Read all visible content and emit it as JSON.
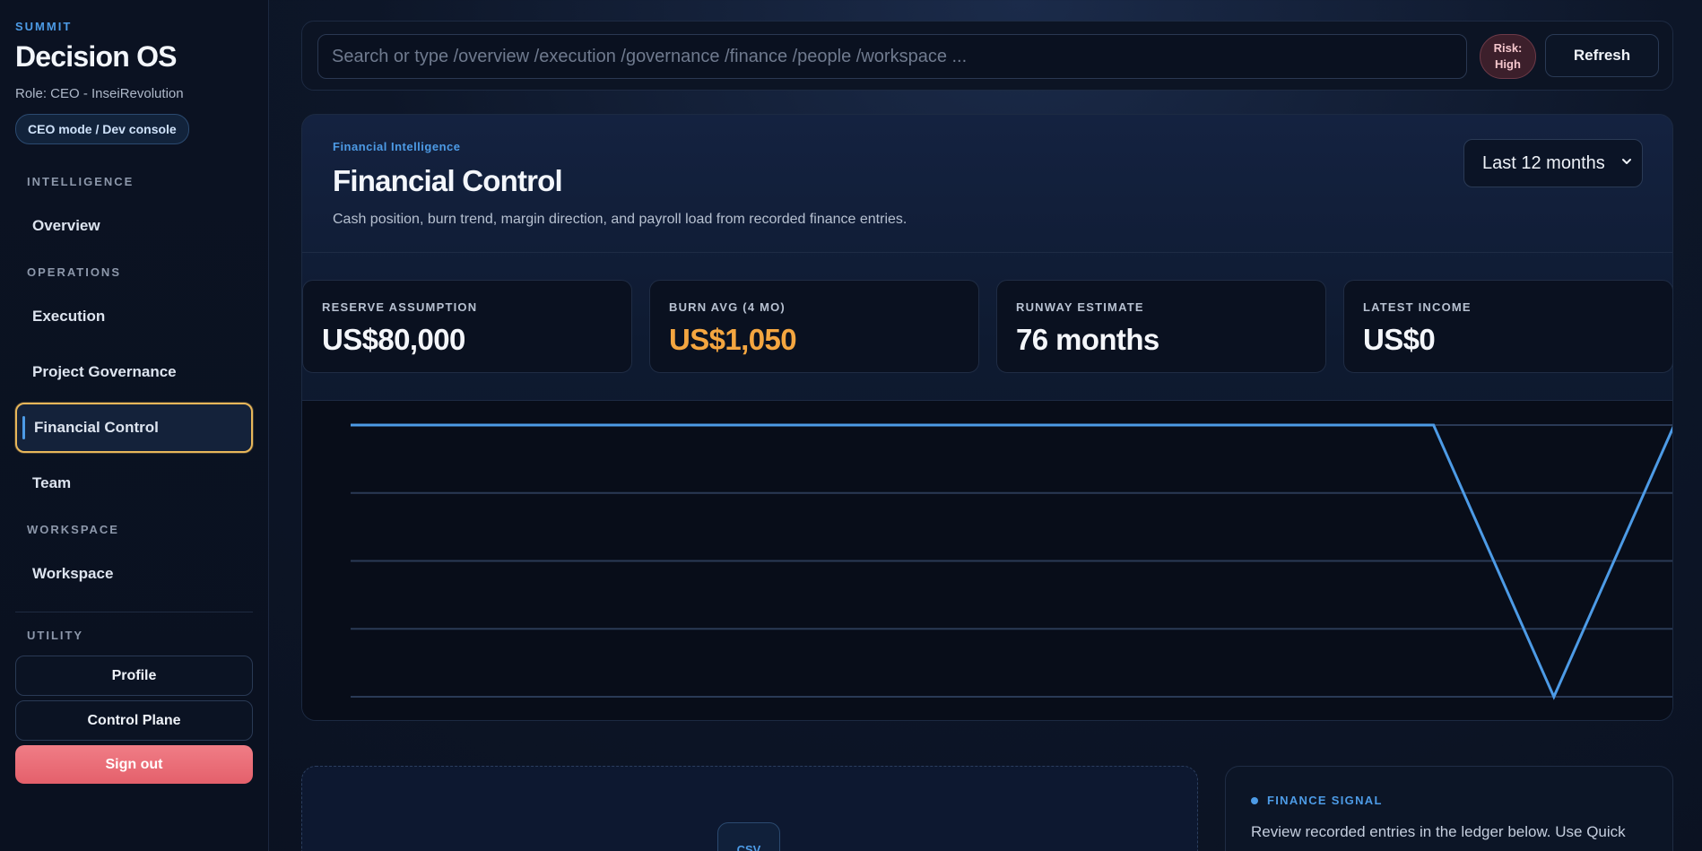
{
  "sidebar": {
    "kicker": "SUMMIT",
    "title": "Decision OS",
    "role": "Role: CEO - InseiRevolution",
    "mode": "CEO mode / Dev console",
    "sections": {
      "intelligence": "INTELLIGENCE",
      "operations": "OPERATIONS",
      "workspace": "WORKSPACE",
      "utility": "UTILITY"
    },
    "items": {
      "overview": "Overview",
      "execution": "Execution",
      "project_governance": "Project Governance",
      "financial_control": "Financial Control",
      "team": "Team",
      "workspace": "Workspace"
    },
    "active_item": "Financial Control",
    "utility_buttons": {
      "profile": "Profile",
      "control_plane": "Control Plane",
      "sign_out": "Sign out"
    }
  },
  "topbar": {
    "search_placeholder": "Search or type /overview /execution /governance /finance /people /workspace ...",
    "search_value": "",
    "risk_line1": "Risk:",
    "risk_line2": "High",
    "refresh_label": "Refresh"
  },
  "panel": {
    "kicker": "Financial Intelligence",
    "title": "Financial Control",
    "subtitle": "Cash position, burn trend, margin direction, and payroll load from recorded finance entries.",
    "range_selected": "Last 12 months"
  },
  "kpis": [
    {
      "label": "RESERVE ASSUMPTION",
      "value": "US$80,000",
      "tone": "normal"
    },
    {
      "label": "BURN AVG (4 MO)",
      "value": "US$1,050",
      "tone": "warn"
    },
    {
      "label": "RUNWAY ESTIMATE",
      "value": "76 months",
      "tone": "normal"
    },
    {
      "label": "LATEST INCOME",
      "value": "US$0",
      "tone": "normal"
    }
  ],
  "chart_data": {
    "type": "line",
    "title": "",
    "xlabel": "",
    "ylabel": "",
    "grid": true,
    "gridlines": 5,
    "ylim": [
      0,
      1
    ],
    "series": [
      {
        "values": [
          1,
          1,
          1,
          1,
          1,
          1,
          1,
          1,
          1,
          1,
          0,
          1
        ],
        "color": "#4d9be6"
      }
    ]
  },
  "csv": {
    "chip_label": "CSV"
  },
  "signal": {
    "heading": "FINANCE SIGNAL",
    "body": "Review recorded entries in the ledger below. Use Quick Capture for manual transactions. Anomaly spots through"
  },
  "colors": {
    "accent": "#4d9be6",
    "active_outline": "#e8b75a",
    "warn": "#f4a640",
    "danger": "#e4606b"
  }
}
